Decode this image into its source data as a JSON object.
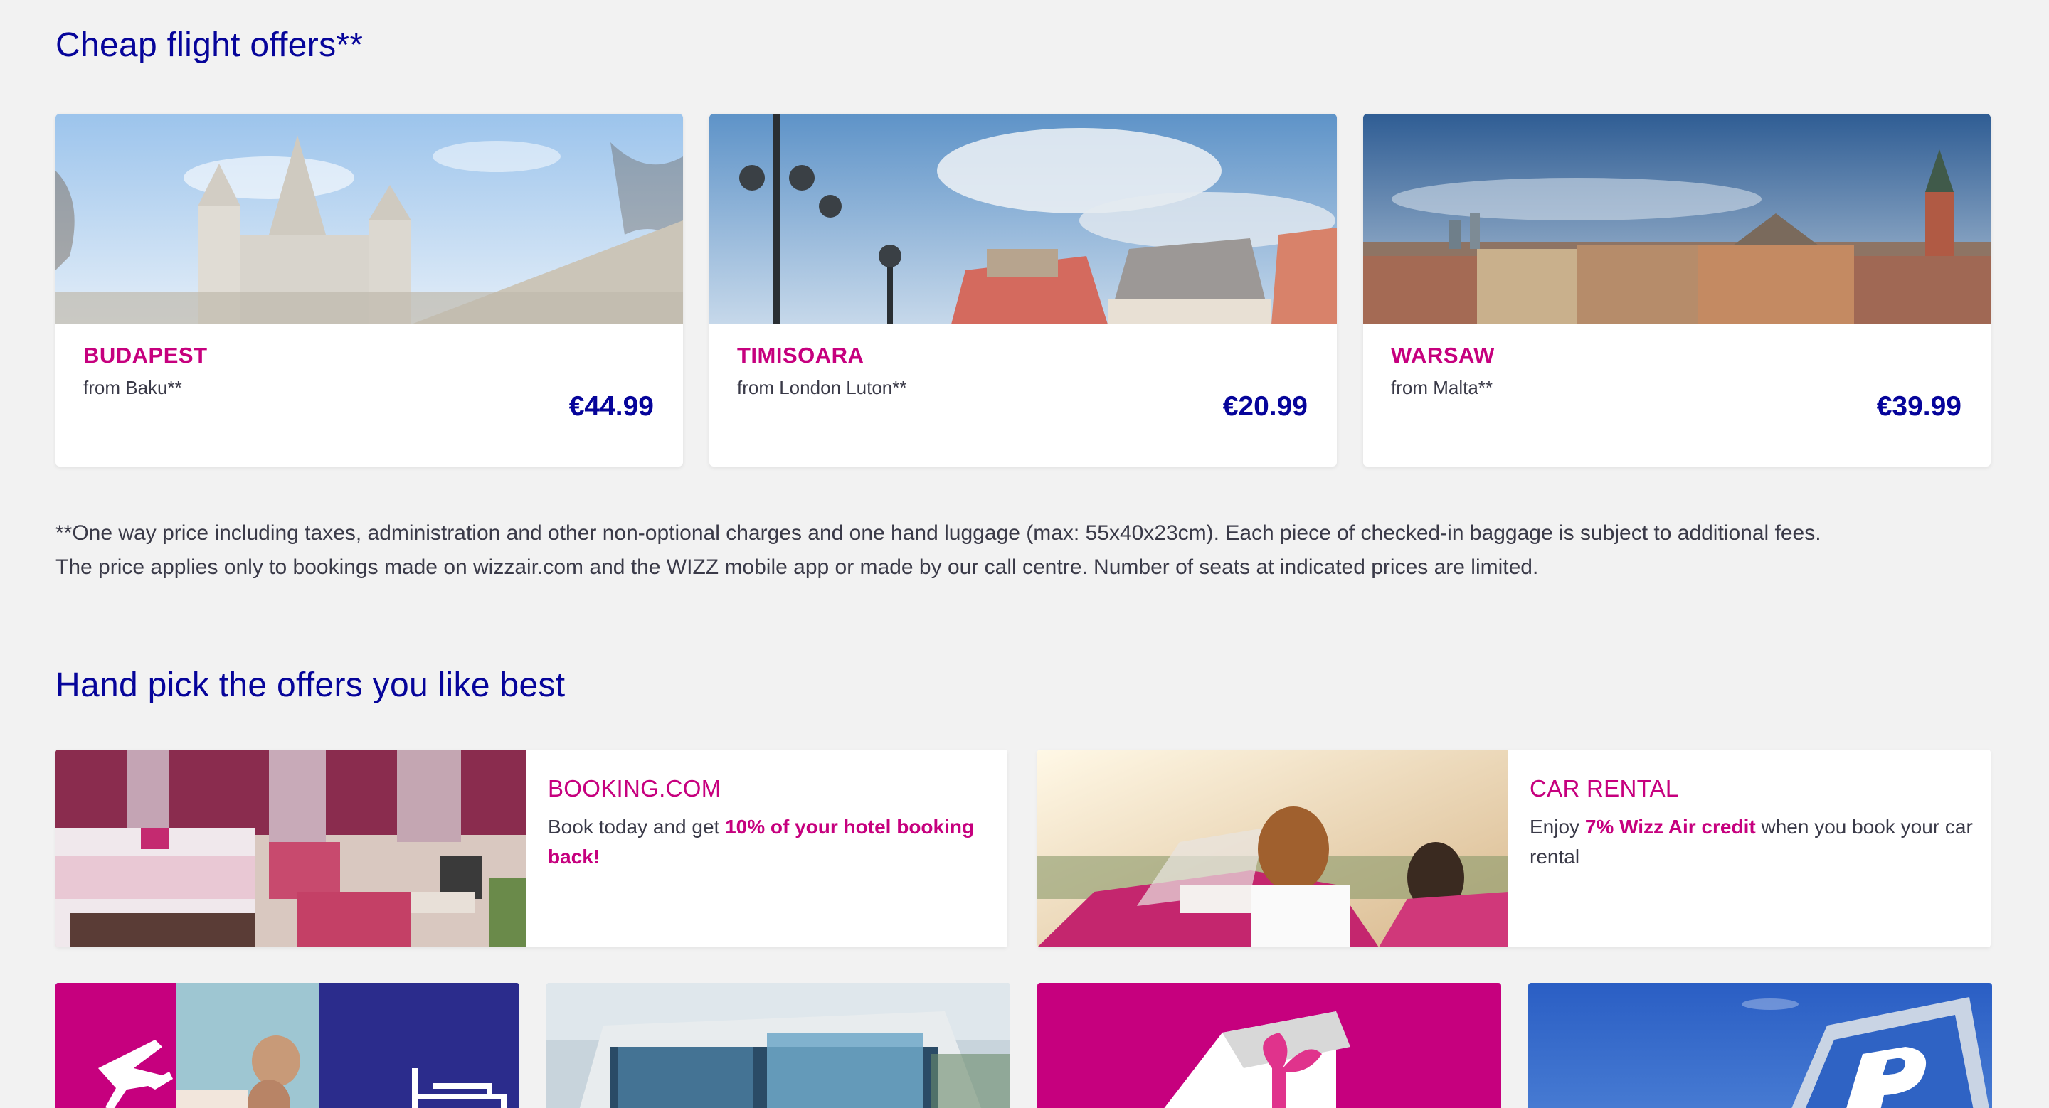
{
  "sections": {
    "cheap_flights_title": "Cheap flight offers**",
    "hand_pick_title": "Hand pick the offers you like best"
  },
  "flight_offers": [
    {
      "city": "BUDAPEST",
      "from": "from Baku**",
      "price": "€44.99"
    },
    {
      "city": "TIMISOARA",
      "from": "from London Luton**",
      "price": "€20.99"
    },
    {
      "city": "WARSAW",
      "from": "from Malta**",
      "price": "€39.99"
    }
  ],
  "footnote": {
    "line1": "**One way price including taxes, administration and other non-optional charges and one hand luggage (max: 55x40x23cm). Each piece of checked-in baggage is subject to additional fees.",
    "line2": "The price applies only to bookings made on wizzair.com and the WIZZ mobile app or made by our call centre. Number of seats at indicated prices are limited."
  },
  "partner_offers": {
    "booking": {
      "title": "BOOKING.COM",
      "text_before": "Book today and get ",
      "highlight": "10% of your hotel booking back!",
      "text_after": ""
    },
    "car_rental": {
      "title": "CAR RENTAL",
      "text_before": "Enjoy ",
      "highlight": "7% Wizz Air credit",
      "text_after": " when you book your car rental"
    }
  },
  "colors": {
    "brand_navy": "#06049a",
    "brand_magenta": "#c6007e",
    "background": "#f2f2f2"
  },
  "icons": [
    "airplane-icon",
    "bed-icon",
    "parking-sign-icon",
    "gift-icon"
  ]
}
